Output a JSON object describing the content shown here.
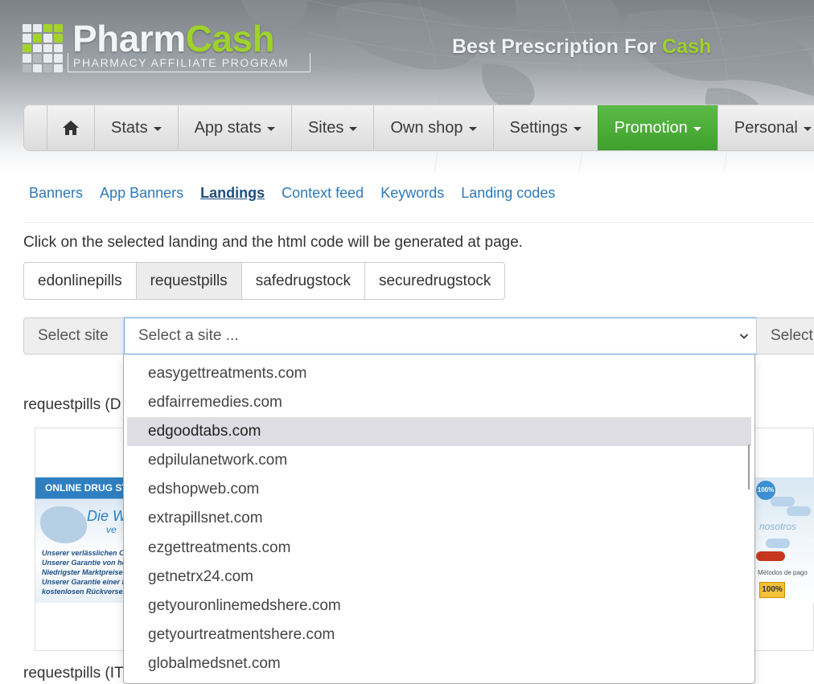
{
  "brand": {
    "name_part1": "Pharm",
    "name_part2": "Cash",
    "subtitle": "PHARMACY AFFILIATE PROGRAM",
    "tagline_part1": "Best Prescription For ",
    "tagline_part2": "Cash",
    "accent_color": "#9fd22a"
  },
  "nav": {
    "home_icon": "home-icon",
    "items": [
      {
        "label": "Stats"
      },
      {
        "label": "App stats"
      },
      {
        "label": "Sites"
      },
      {
        "label": "Own shop"
      },
      {
        "label": "Settings"
      },
      {
        "label": "Promotion",
        "active": true
      },
      {
        "label": "Personal"
      }
    ],
    "active_color": "#47a834"
  },
  "subnav": {
    "items": [
      {
        "label": "Banners"
      },
      {
        "label": "App Banners"
      },
      {
        "label": "Landings",
        "active": true
      },
      {
        "label": "Context feed"
      },
      {
        "label": "Keywords"
      },
      {
        "label": "Landing codes"
      }
    ]
  },
  "instruction": "Click on the selected landing and the html code will be generated at page.",
  "landings": {
    "buttons": [
      {
        "label": "edonlinepills"
      },
      {
        "label": "requestpills",
        "selected": true
      },
      {
        "label": "safedrugstock"
      },
      {
        "label": "securedrugstock"
      }
    ]
  },
  "site_select": {
    "addon_label": "Select site",
    "placeholder": "Select a site ...",
    "addon_right_label": "Select",
    "options": [
      "easygettreatments.com",
      "edfairremedies.com",
      "edgoodtabs.com",
      "edpilulanetwork.com",
      "edshopweb.com",
      "extrapillsnet.com",
      "ezgettreatments.com",
      "getnetrx24.com",
      "getyouronlinemedshere.com",
      "getyourtreatmentshere.com",
      "globalmedsnet.com"
    ],
    "highlighted_index": 2
  },
  "previews": {
    "label_1": "requestpills (D",
    "label_2": "requestpills (IT",
    "banner_left": {
      "title": "ONLINE DRUG ST",
      "headline": "Die W",
      "headline_tail": "ve",
      "lines": [
        "Unserer verlässlichen Online",
        "Unserer Garantie von hoher Q",
        "Niedrigster Marktpreise",
        "Unserer Garantie einer kompl",
        "kostenlosen Rückversendung"
      ]
    },
    "banner_right": {
      "badge": "100%",
      "text": "nosotros",
      "footer": "Métodos de pago",
      "seal": "100%"
    }
  }
}
